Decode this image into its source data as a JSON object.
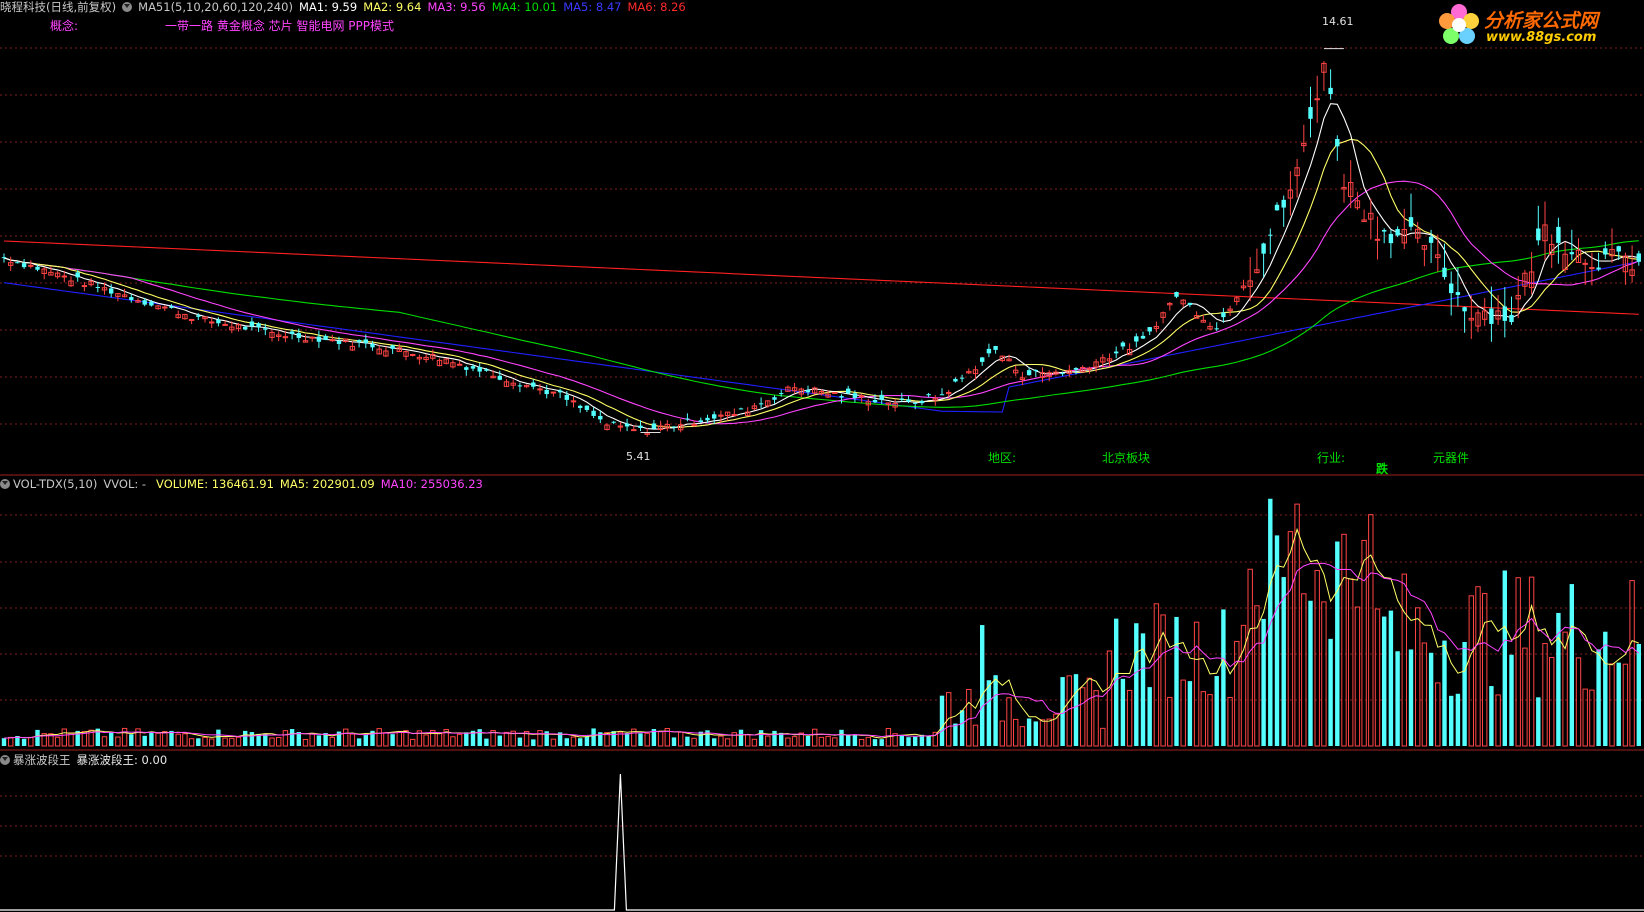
{
  "price_header": {
    "stock": "晓程科技(日线,前复权)",
    "ma_title": "MA51(5,10,20,60,120,240)",
    "ma1": "MA1: 9.59",
    "ma2": "MA2: 9.64",
    "ma3": "MA3: 9.56",
    "ma4": "MA4: 10.01",
    "ma5": "MA5: 8.47",
    "ma6": "MA6: 8.26",
    "concept_label": "概念:",
    "concepts": "一带一路 黄金概念 芯片 智能电网 PPP模式"
  },
  "price_annotations": {
    "high": "14.61",
    "low": "5.41",
    "region_label": "地区:",
    "region_value": "北京板块",
    "industry_label": "行业:",
    "industry_value": "元器件",
    "signal": "跌"
  },
  "volume_header": {
    "title": "VOL-TDX(5,10)",
    "vvol": "VVOL: -",
    "volume": "VOLUME: 136461.91",
    "ma5": "MA5: 202901.09",
    "ma10": "MA10: 255036.23"
  },
  "indicator_header": {
    "title": "暴涨波段王",
    "value": "暴涨波段王: 0.00"
  },
  "logo": {
    "name": "分析家公式网",
    "url": "www.88gs.com"
  },
  "colors": {
    "background": "#000000",
    "up_candle": "#ff4444",
    "down_candle": "#54ffff",
    "ma1": "#ffffff",
    "ma2": "#ffff66",
    "ma3": "#ff44ff",
    "ma4": "#00dd00",
    "ma5": "#2020ff",
    "ma6": "#ff2020",
    "grid": "#802020",
    "concept": "#ff44ff",
    "info": "#00e000"
  }
}
